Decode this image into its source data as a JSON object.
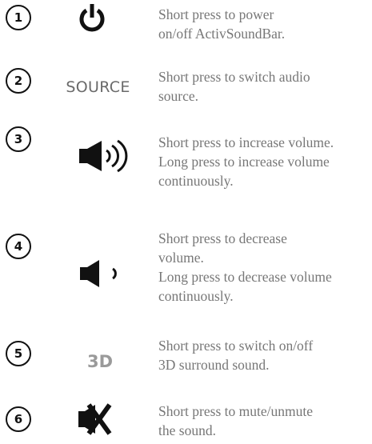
{
  "items": [
    {
      "number": "1",
      "icon": "power-icon",
      "lines": [
        "Short press to power",
        "on/off ActivSoundBar."
      ]
    },
    {
      "number": "2",
      "icon_text": "SOURCE",
      "lines": [
        "Short press to switch audio",
        "source."
      ]
    },
    {
      "number": "3",
      "icon": "volume-up-icon",
      "lines": [
        "Short press to increase volume.",
        "Long press to increase volume",
        "continuously."
      ]
    },
    {
      "number": "4",
      "icon": "volume-down-icon",
      "lines": [
        "Short press to decrease",
        "volume.",
        "Long press to decrease volume",
        "continuously."
      ]
    },
    {
      "number": "5",
      "icon_text": "3D",
      "lines": [
        "Short press to switch on/off",
        "3D surround sound."
      ]
    },
    {
      "number": "6",
      "icon": "mute-icon",
      "lines": [
        "Short press to mute/unmute",
        "the sound."
      ]
    }
  ]
}
